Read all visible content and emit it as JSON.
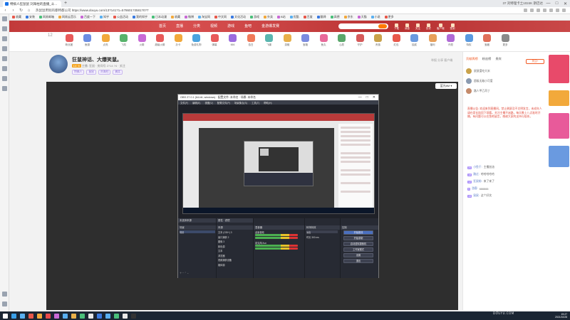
{
  "browser": {
    "tab_title": "特搞人狂鼠鼠 刘海柱的直播_斗...",
    "new_tab": "+",
    "window_right": [
      "37 刘特理卡土1024K 斯巴达",
      "—",
      "□",
      "✕"
    ],
    "url": "https://www.douyu.com/13?141?1=578601?3581?0?7",
    "url_prefix": "热鼠鼠用别的都特都公司",
    "bookmarks": [
      "收藏",
      "安装",
      "网易邮箱",
      "网易云音乐",
      "百度一下",
      "知乎",
      "公益活动",
      "我的知乎",
      "日本动漫",
      "收藏",
      "微博",
      "淘宝网",
      "中文网",
      "文化活动",
      "游戏",
      "外卖",
      "B站",
      "优酷",
      "百度",
      "翻译",
      "高德",
      "京东",
      "天猫",
      "小说",
      "更多"
    ]
  },
  "site_header": {
    "menu": [
      "首页",
      "直播",
      "分类",
      "视频",
      "游戏",
      "鱼吧",
      "金游爆发赛"
    ],
    "icons": [
      "下载",
      "消息",
      "关注",
      "历史",
      "客户端",
      "签到"
    ]
  },
  "gift_row": {
    "level_label": "12",
    "items": [
      "粉丝团",
      "鱼翅",
      "点亮",
      "飞机",
      "火箭",
      "超级火箭",
      "办卡",
      "免费礼物",
      "弹幕",
      "666",
      "告白",
      "飞碟",
      "游艇",
      "宝箱",
      "鱼丸",
      "心愿",
      "守护",
      "贵族",
      "红包",
      "抽奖",
      "福利",
      "许愿",
      "特权",
      "宝藏",
      "更多"
    ],
    "colors": [
      "#e85a5a",
      "#6b8de3",
      "#f2a93b",
      "#57b36b",
      "#c86ad6",
      "#e85a5a",
      "#f2a93b",
      "#4aa3df",
      "#e85a5a",
      "#9b6bdf",
      "#f07a5a",
      "#5ab6b0",
      "#e8b04a",
      "#7a8be0",
      "#e86a9a",
      "#5aa76a",
      "#d65a5a",
      "#c9a24a",
      "#e8584a",
      "#6a9ae0",
      "#e8a05a",
      "#b06ad6",
      "#5a9ae0",
      "#e0705a",
      "#8a8a8a"
    ]
  },
  "streamer": {
    "title": "狂鼠神话、大爆笑鼠。",
    "meta_badge": "LV. 5",
    "meta": "主播: 狂鼠 · 房间号 2?14 ?4 · 关注",
    "tags": [
      "特搞人",
      "鼠鼠",
      "刘海柱",
      "搞笑"
    ],
    "report": "举报 分享 客户端"
  },
  "player": {
    "quality": "蓝光8M ▾"
  },
  "obs": {
    "title": "OBS 27.0.1 (64-bit, windows) · 配置文件: 未命名 · 场景: 未命名",
    "menu": [
      "文件(F)",
      "编辑(E)",
      "视图(V)",
      "配置文件(P)",
      "场景集合(S)",
      "工具(T)",
      "帮助(H)"
    ],
    "window_controls": [
      "—",
      "□",
      "✕"
    ],
    "docks": {
      "scenes_title": "场景",
      "scenes": [
        "场景"
      ],
      "sources_title": "来源",
      "sources": [
        "文本 (GDI+) 3",
        "窗口捕获 2",
        "图像 3",
        "颜色源",
        "文本",
        "浏览器",
        "视频捕获设备",
        "媒体源"
      ],
      "mixer_title": "混音器",
      "mixer": [
        "桌面音频",
        "麦克风/Aux"
      ],
      "transitions_title": "转场特效",
      "transition_type": "淡出",
      "transition_duration": "时长 300 ms",
      "controls_title": "控制",
      "controls": [
        "开始推流",
        "开始录制",
        "启动虚拟摄像机",
        "工作室模式",
        "设置",
        "退出"
      ]
    },
    "source_toolbar": [
      "属性",
      "滤镜"
    ],
    "no_source_label": "未选择来源"
  },
  "chat": {
    "rank_tabs": [
      "贡献周榜",
      "粉丝榜",
      "贵宾"
    ],
    "subscribe": "关注+",
    "fans": [
      "鼠鼠爱吃大米",
      "超级无敌小可爱",
      "路人甲乙丙丁"
    ],
    "fan_colors": [
      "#c9a24a",
      "#8a9ab0",
      "#c48a6a"
    ],
    "notice": "直播公告: 欢迎来到直播间，禁止刷屏及不文明发言，未成年人请在家长陪同下观看。关注主播不迷路，每天晚上八点准时开播，有问题可以在鱼吧留言，感谢大家的支持与陪伴。",
    "messages": [
      {
        "lv": "20",
        "user": "小鱼干: ",
        "text": "主播加油"
      },
      {
        "lv": "18",
        "user": "路过: ",
        "text": "哈哈哈哈哈"
      },
      {
        "lv": "12",
        "user": "狂鼠粉: ",
        "text": "来了来了"
      },
      {
        "lv": "9",
        "user": "游客: ",
        "text": "666666"
      },
      {
        "lv": "15",
        "user": "鼠鼠: ",
        "text": "这个好笑"
      }
    ],
    "ad_colors": [
      "#e84a6a",
      "#f2a93b",
      "#e85a9a",
      "#6a9ae0"
    ]
  },
  "taskbar": {
    "clock_time": "19:27",
    "clock_date": "2021/10/28",
    "icons": [
      "#ffffff",
      "#3aa0e8",
      "#5ab0f0",
      "#e8584a",
      "#f2a93b",
      "#e84a4a",
      "#c86ad6",
      "#5ab0f0",
      "#e8b04a",
      "#4ac07a",
      "#e8e8e8",
      "#3a7ae0",
      "#5ab0f0",
      "#4ac07a",
      "#e8e8e8",
      "#333333"
    ]
  },
  "watermark": {
    "logo": "斗鱼",
    "domain": "DOUYU.COM"
  }
}
